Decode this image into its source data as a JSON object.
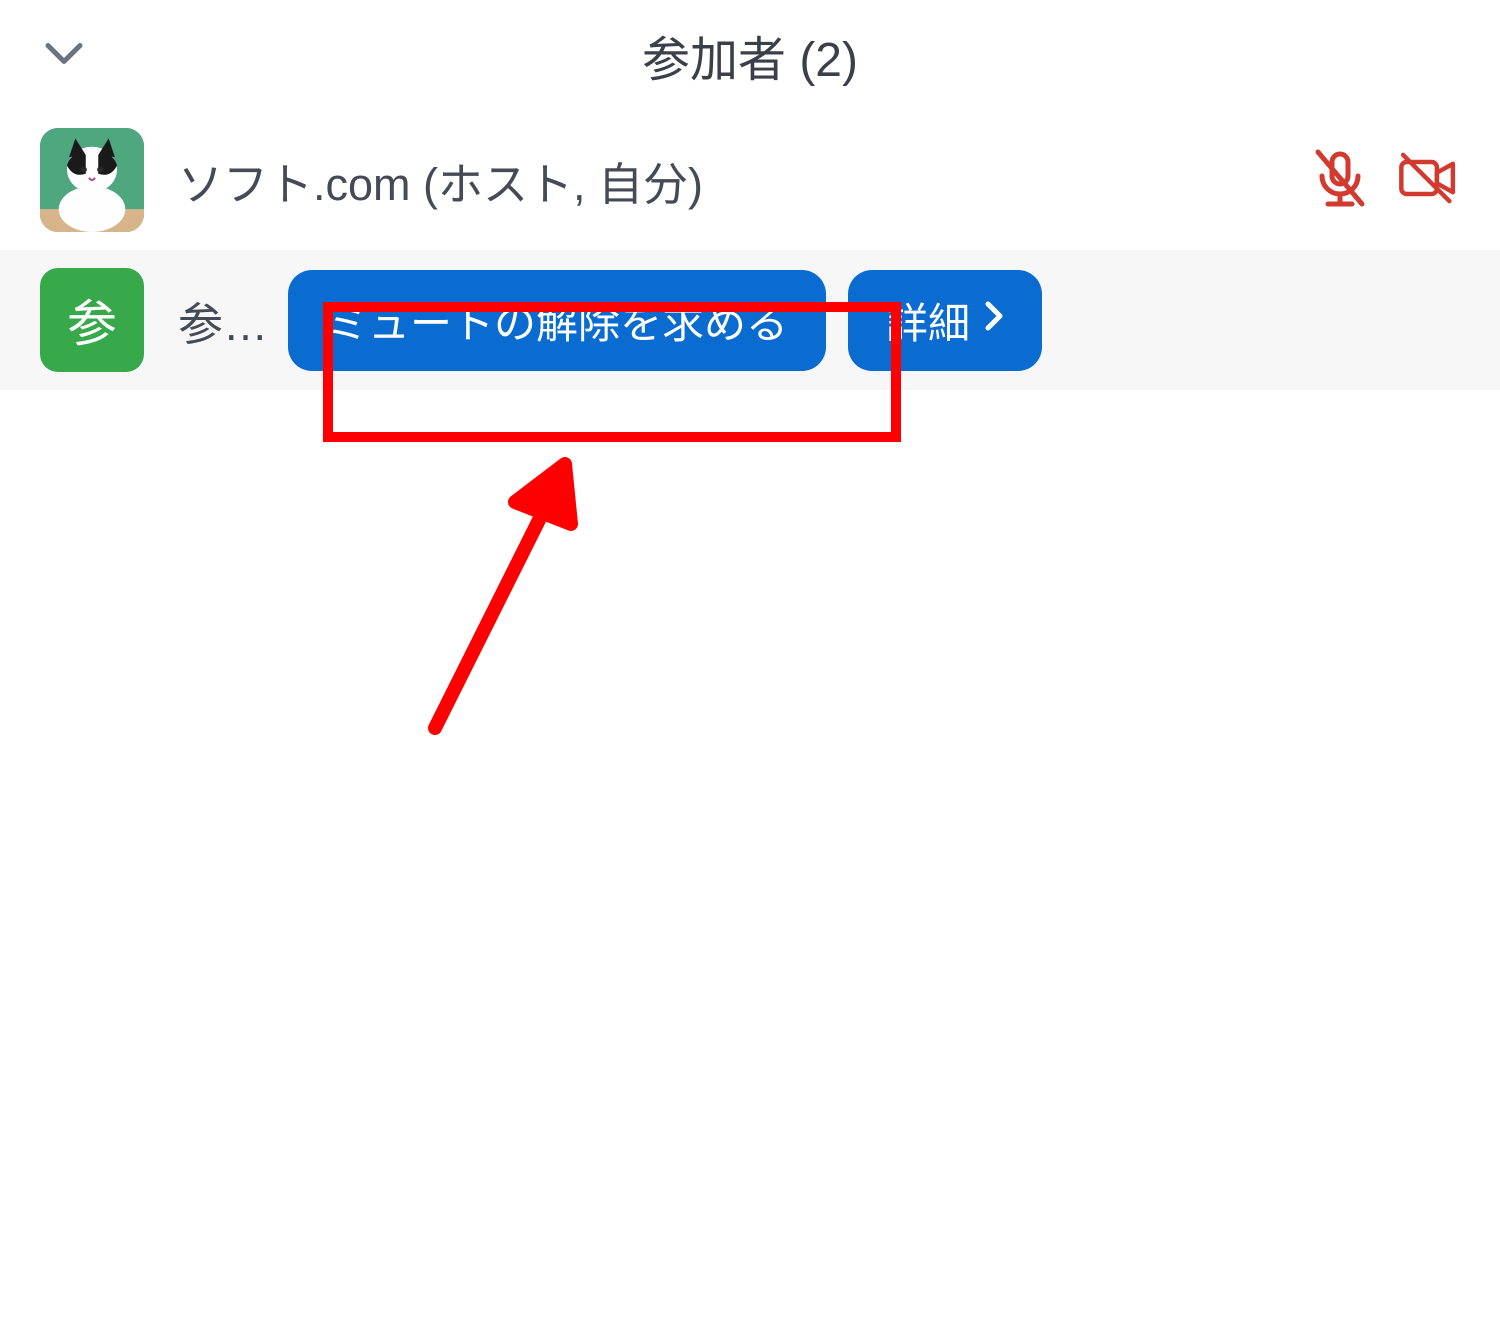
{
  "header": {
    "title": "参加者 (2)"
  },
  "participants": [
    {
      "display_name": "ソフト.com (ホスト, 自分)",
      "avatar_type": "image",
      "mic_muted": true,
      "video_off": true
    },
    {
      "display_name": "参…",
      "avatar_type": "initial",
      "avatar_initial": "参",
      "hovered": true
    }
  ],
  "buttons": {
    "ask_unmute": "ミュートの解除を求める",
    "details": "詳細"
  },
  "annotation": {
    "highlight_target": "ask-unmute-button"
  }
}
